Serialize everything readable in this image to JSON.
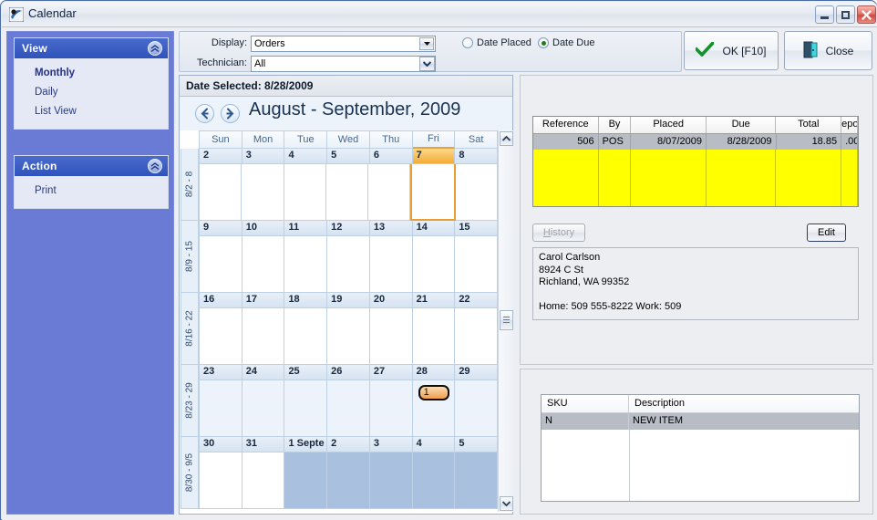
{
  "window": {
    "title": "Calendar",
    "icon": "calendar-app-icon",
    "controls": {
      "minimize": "minimize-icon",
      "maximize": "maximize-icon",
      "close": "close-icon"
    }
  },
  "sidebar": {
    "panels": [
      {
        "title": "View",
        "collapse_icon": "chevron-up-icon",
        "items": [
          {
            "label": "Monthly",
            "selected": true
          },
          {
            "label": "Daily",
            "selected": false
          },
          {
            "label": "List View",
            "selected": false
          }
        ]
      },
      {
        "title": "Action",
        "collapse_icon": "chevron-up-icon",
        "items": [
          {
            "label": "Print",
            "selected": false
          }
        ]
      }
    ]
  },
  "toolbar": {
    "display_label": "Display:",
    "display_value": "Orders",
    "technician_label": "Technician:",
    "technician_value": "All",
    "radios": [
      {
        "label": "Date Placed",
        "checked": false
      },
      {
        "label": "Date Due",
        "checked": true
      }
    ],
    "ok_label": "OK [F10]",
    "ok_icon": "green-check-icon",
    "close_label": "Close",
    "close_icon": "exit-door-icon"
  },
  "calendar": {
    "date_selected_label": "Date Selected:  8/28/2009",
    "prev_icon": "arrow-left-icon",
    "next_icon": "arrow-right-icon",
    "month_title": "August - September, 2009",
    "day_names": [
      "Sun",
      "Mon",
      "Tue",
      "Wed",
      "Thu",
      "Fri",
      "Sat"
    ],
    "highlighted_day_name": "Fri",
    "weeks": [
      {
        "range_label": "8/2 - 8",
        "selected": false,
        "days": [
          {
            "num": "2",
            "today": false,
            "other_month": false,
            "badge": null
          },
          {
            "num": "3",
            "today": false,
            "other_month": false,
            "badge": null
          },
          {
            "num": "4",
            "today": false,
            "other_month": false,
            "badge": null
          },
          {
            "num": "5",
            "today": false,
            "other_month": false,
            "badge": null
          },
          {
            "num": "6",
            "today": false,
            "other_month": false,
            "badge": null
          },
          {
            "num": "7",
            "today": true,
            "other_month": false,
            "badge": null
          },
          {
            "num": "8",
            "today": false,
            "other_month": false,
            "badge": null
          }
        ]
      },
      {
        "range_label": "8/9 - 15",
        "selected": false,
        "days": [
          {
            "num": "9",
            "today": false,
            "other_month": false,
            "badge": null
          },
          {
            "num": "10",
            "today": false,
            "other_month": false,
            "badge": null
          },
          {
            "num": "11",
            "today": false,
            "other_month": false,
            "badge": null
          },
          {
            "num": "12",
            "today": false,
            "other_month": false,
            "badge": null
          },
          {
            "num": "13",
            "today": false,
            "other_month": false,
            "badge": null
          },
          {
            "num": "14",
            "today": false,
            "other_month": false,
            "badge": null
          },
          {
            "num": "15",
            "today": false,
            "other_month": false,
            "badge": null
          }
        ]
      },
      {
        "range_label": "8/16 - 22",
        "selected": false,
        "days": [
          {
            "num": "16",
            "today": false,
            "other_month": false,
            "badge": null
          },
          {
            "num": "17",
            "today": false,
            "other_month": false,
            "badge": null
          },
          {
            "num": "18",
            "today": false,
            "other_month": false,
            "badge": null
          },
          {
            "num": "19",
            "today": false,
            "other_month": false,
            "badge": null
          },
          {
            "num": "20",
            "today": false,
            "other_month": false,
            "badge": null
          },
          {
            "num": "21",
            "today": false,
            "other_month": false,
            "badge": null
          },
          {
            "num": "22",
            "today": false,
            "other_month": false,
            "badge": null
          }
        ]
      },
      {
        "range_label": "8/23 - 29",
        "selected": true,
        "days": [
          {
            "num": "23",
            "today": false,
            "other_month": false,
            "badge": null
          },
          {
            "num": "24",
            "today": false,
            "other_month": false,
            "badge": null
          },
          {
            "num": "25",
            "today": false,
            "other_month": false,
            "badge": null
          },
          {
            "num": "26",
            "today": false,
            "other_month": false,
            "badge": null
          },
          {
            "num": "27",
            "today": false,
            "other_month": false,
            "badge": null
          },
          {
            "num": "28",
            "today": false,
            "other_month": false,
            "badge": "1"
          },
          {
            "num": "29",
            "today": false,
            "other_month": false,
            "badge": null
          }
        ]
      },
      {
        "range_label": "8/30 - 9/5",
        "selected": false,
        "days": [
          {
            "num": "30",
            "today": false,
            "other_month": false,
            "badge": null
          },
          {
            "num": "31",
            "today": false,
            "other_month": false,
            "badge": null
          },
          {
            "num": "1 Septe",
            "today": false,
            "other_month": true,
            "badge": null
          },
          {
            "num": "2",
            "today": false,
            "other_month": true,
            "badge": null
          },
          {
            "num": "3",
            "today": false,
            "other_month": true,
            "badge": null
          },
          {
            "num": "4",
            "today": false,
            "other_month": true,
            "badge": null
          },
          {
            "num": "5",
            "today": false,
            "other_month": true,
            "badge": null
          }
        ]
      }
    ],
    "scrollbar": {
      "up_icon": "chevron-up-icon",
      "down_icon": "chevron-down-icon",
      "thumb_icon": "scroll-thumb-grip"
    }
  },
  "orders": {
    "columns": [
      "Reference",
      "By",
      "Placed",
      "Due",
      "Total",
      "epo"
    ],
    "rows": [
      {
        "reference": "506",
        "by": "POS",
        "placed": "8/07/2009",
        "due": "8/28/2009",
        "total": "18.85",
        "deposit": ".00"
      }
    ],
    "history_label": "History",
    "history_accesskey": "H",
    "history_rest": "istory",
    "edit_label": "Edit"
  },
  "customer": {
    "name": "Carol Carlson",
    "street": "8924 C St",
    "city_state_zip": "Richland, WA  99352",
    "phones": "Home: 509 555-8222   Work: 509"
  },
  "items": {
    "columns": [
      "SKU",
      "Description"
    ],
    "rows": [
      {
        "sku": "N",
        "description": "NEW ITEM"
      }
    ]
  },
  "colors": {
    "sidebar_blue": "#6a7bd6",
    "panel_header_blue": "#2f53bb",
    "today_orange": "#f2ab38",
    "grid_yellow": "#ffff00",
    "other_month_blue": "#a9c1de",
    "selected_row_gray": "#b8bcc4"
  }
}
